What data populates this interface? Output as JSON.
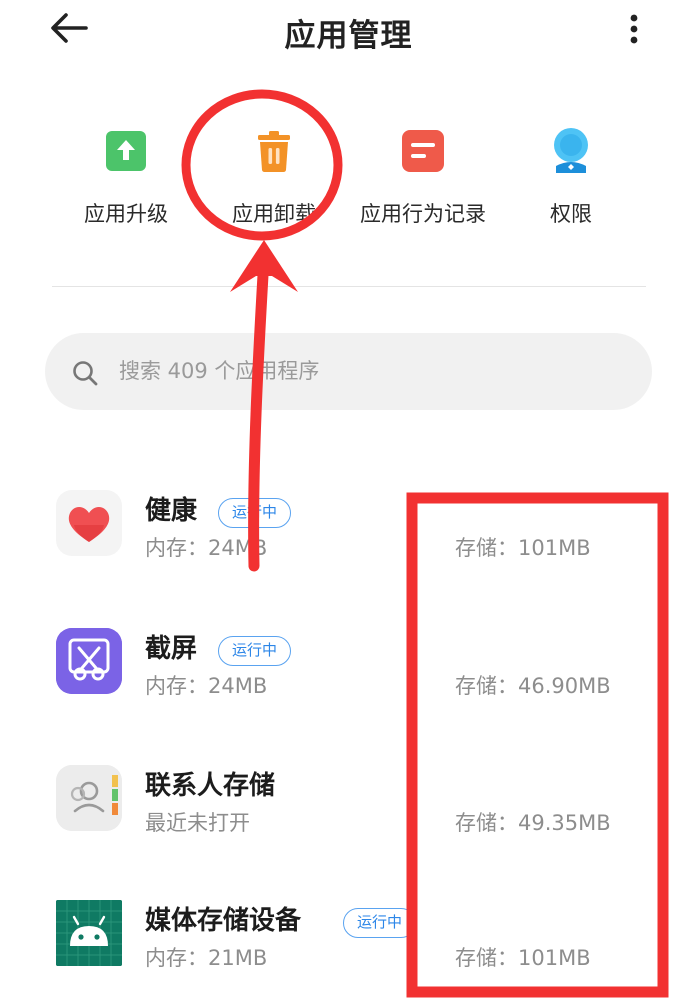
{
  "header": {
    "title": "应用管理",
    "back_icon": "arrow-left-icon",
    "more_icon": "more-vertical-icon"
  },
  "shortcuts": [
    {
      "label": "应用升级",
      "icon": "upgrade-arrow-icon",
      "color": "#4cc46a"
    },
    {
      "label": "应用卸载",
      "icon": "trash-icon",
      "color": "#f39227"
    },
    {
      "label": "应用行为记录",
      "icon": "record-list-icon",
      "color": "#ef5a4a"
    },
    {
      "label": "权限",
      "icon": "permission-person-icon",
      "color": "#3bb7ef"
    }
  ],
  "search": {
    "placeholder": "搜索 409 个应用程序",
    "icon": "search-icon"
  },
  "apps": [
    {
      "name": "健康",
      "badge": "运行中",
      "sub": "内存：24MB",
      "storage": "存储：101MB",
      "icon": "heart-icon"
    },
    {
      "name": "截屏",
      "badge": "运行中",
      "sub": "内存：24MB",
      "storage": "存储：46.90MB",
      "icon": "screenshot-scissors-icon"
    },
    {
      "name": "联系人存储",
      "badge": "",
      "sub": "最近未打开",
      "storage": "存储：49.35MB",
      "icon": "contacts-icon"
    },
    {
      "name": "媒体存储设备",
      "badge": "运行中",
      "sub": "内存：21MB",
      "storage": "存储：101MB",
      "icon": "android-icon"
    }
  ],
  "annotation": {
    "color": "#f23131",
    "circle_icon": "highlight-circle",
    "arrow_icon": "pointer-arrow",
    "box_icon": "highlight-box"
  }
}
